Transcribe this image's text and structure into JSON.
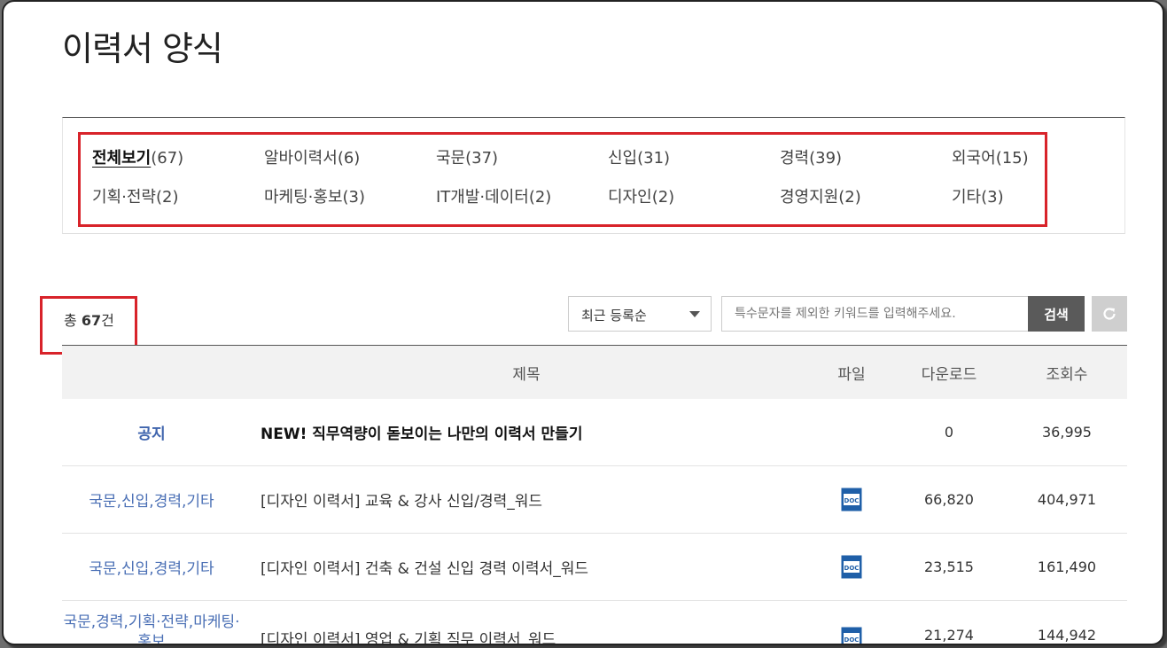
{
  "page": {
    "title": "이력서 양식"
  },
  "categories": [
    {
      "name": "전체보기",
      "count": "(67)",
      "active": true
    },
    {
      "name": "알바이력서",
      "count": "(6)"
    },
    {
      "name": "국문",
      "count": "(37)"
    },
    {
      "name": "신입",
      "count": "(31)"
    },
    {
      "name": "경력",
      "count": "(39)"
    },
    {
      "name": "외국어",
      "count": "(15)"
    },
    {
      "name": "기획·전략",
      "count": "(2)"
    },
    {
      "name": "마케팅·홍보",
      "count": "(3)"
    },
    {
      "name": "IT개발·데이터",
      "count": "(2)"
    },
    {
      "name": "디자인",
      "count": "(2)"
    },
    {
      "name": "경영지원",
      "count": "(2)"
    },
    {
      "name": "기타",
      "count": "(3)"
    }
  ],
  "summary": {
    "prefix": "총 ",
    "count": "67",
    "suffix": "건"
  },
  "toolbar": {
    "sort_label": "최근 등록순",
    "search_placeholder": "특수문자를 제외한 키워드를 입력해주세요.",
    "search_button": "검색"
  },
  "table": {
    "headers": {
      "title": "제목",
      "file": "파일",
      "downloads": "다운로드",
      "views": "조회수"
    },
    "rows": [
      {
        "category": "공지",
        "title": "NEW! 직무역량이 돋보이는 나만의 이력서 만들기",
        "downloads": "0",
        "views": "36,995",
        "file": ""
      },
      {
        "category": "국문,신입,경력,기타",
        "title": "[디자인 이력서] 교육 & 강사 신입/경력_워드",
        "downloads": "66,820",
        "views": "404,971",
        "file": "DOC"
      },
      {
        "category": "국문,신입,경력,기타",
        "title": "[디자인 이력서] 건축 & 건설 신입 경력 이력서_워드",
        "downloads": "23,515",
        "views": "161,490",
        "file": "DOC"
      },
      {
        "category": "국문,경력,기획·전략,마케팅·홍보",
        "title": "[디자인 이력서] 영업 & 기획 직무 이력서_워드",
        "downloads": "21,274",
        "views": "144,942",
        "file": "DOC"
      }
    ]
  },
  "colors": {
    "highlight": "#d8232a",
    "category_link": "#4a6fb5",
    "search_button": "#5a5a5a",
    "doc_icon": "#1f5fa8"
  },
  "icons": {
    "sort": "chevron-down-icon",
    "reset": "refresh-icon",
    "file": "doc-file-icon"
  }
}
